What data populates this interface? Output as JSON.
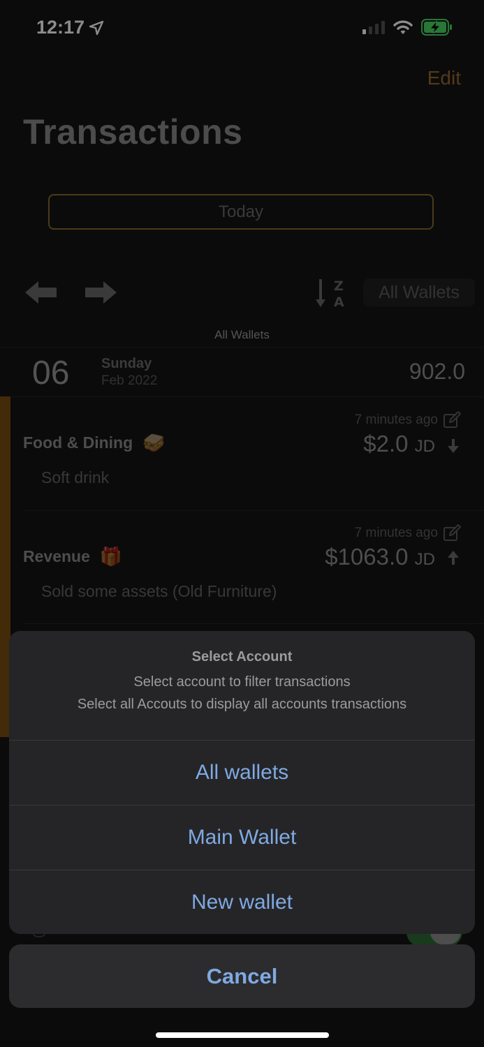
{
  "status": {
    "time": "12:17"
  },
  "header": {
    "edit_label": "Edit",
    "title": "Transactions"
  },
  "filter": {
    "date_label": "Today",
    "wallet_button_label": "All Wallets",
    "wallet_caption": "All Wallets",
    "sort_icon_z": "Z",
    "sort_icon_a": "A"
  },
  "day_group": {
    "day": "06",
    "weekday": "Sunday",
    "month_year": "Feb 2022",
    "total": "902.0"
  },
  "transactions": [
    {
      "category": "Food & Dining",
      "emoji": "🥪",
      "note": "Soft drink",
      "time": "7 minutes ago",
      "amount": "$2.0",
      "currency": "JD",
      "direction": "down"
    },
    {
      "category": "Revenue",
      "emoji": "🎁",
      "note": "Sold some assets (Old Furniture)",
      "time": "7 minutes ago",
      "amount": "$1063.0",
      "currency": "JD",
      "direction": "up"
    }
  ],
  "sheet": {
    "title": "Select Account",
    "message_line1": "Select account to filter transactions",
    "message_line2": "Select all Accouts to display all accounts transactions",
    "options": [
      "All wallets",
      "Main Wallet",
      "New wallet"
    ],
    "cancel_label": "Cancel"
  },
  "colors": {
    "accent": "#9a6a2a",
    "action_blue": "#7fa9e3",
    "battery_green": "#4cd964"
  }
}
